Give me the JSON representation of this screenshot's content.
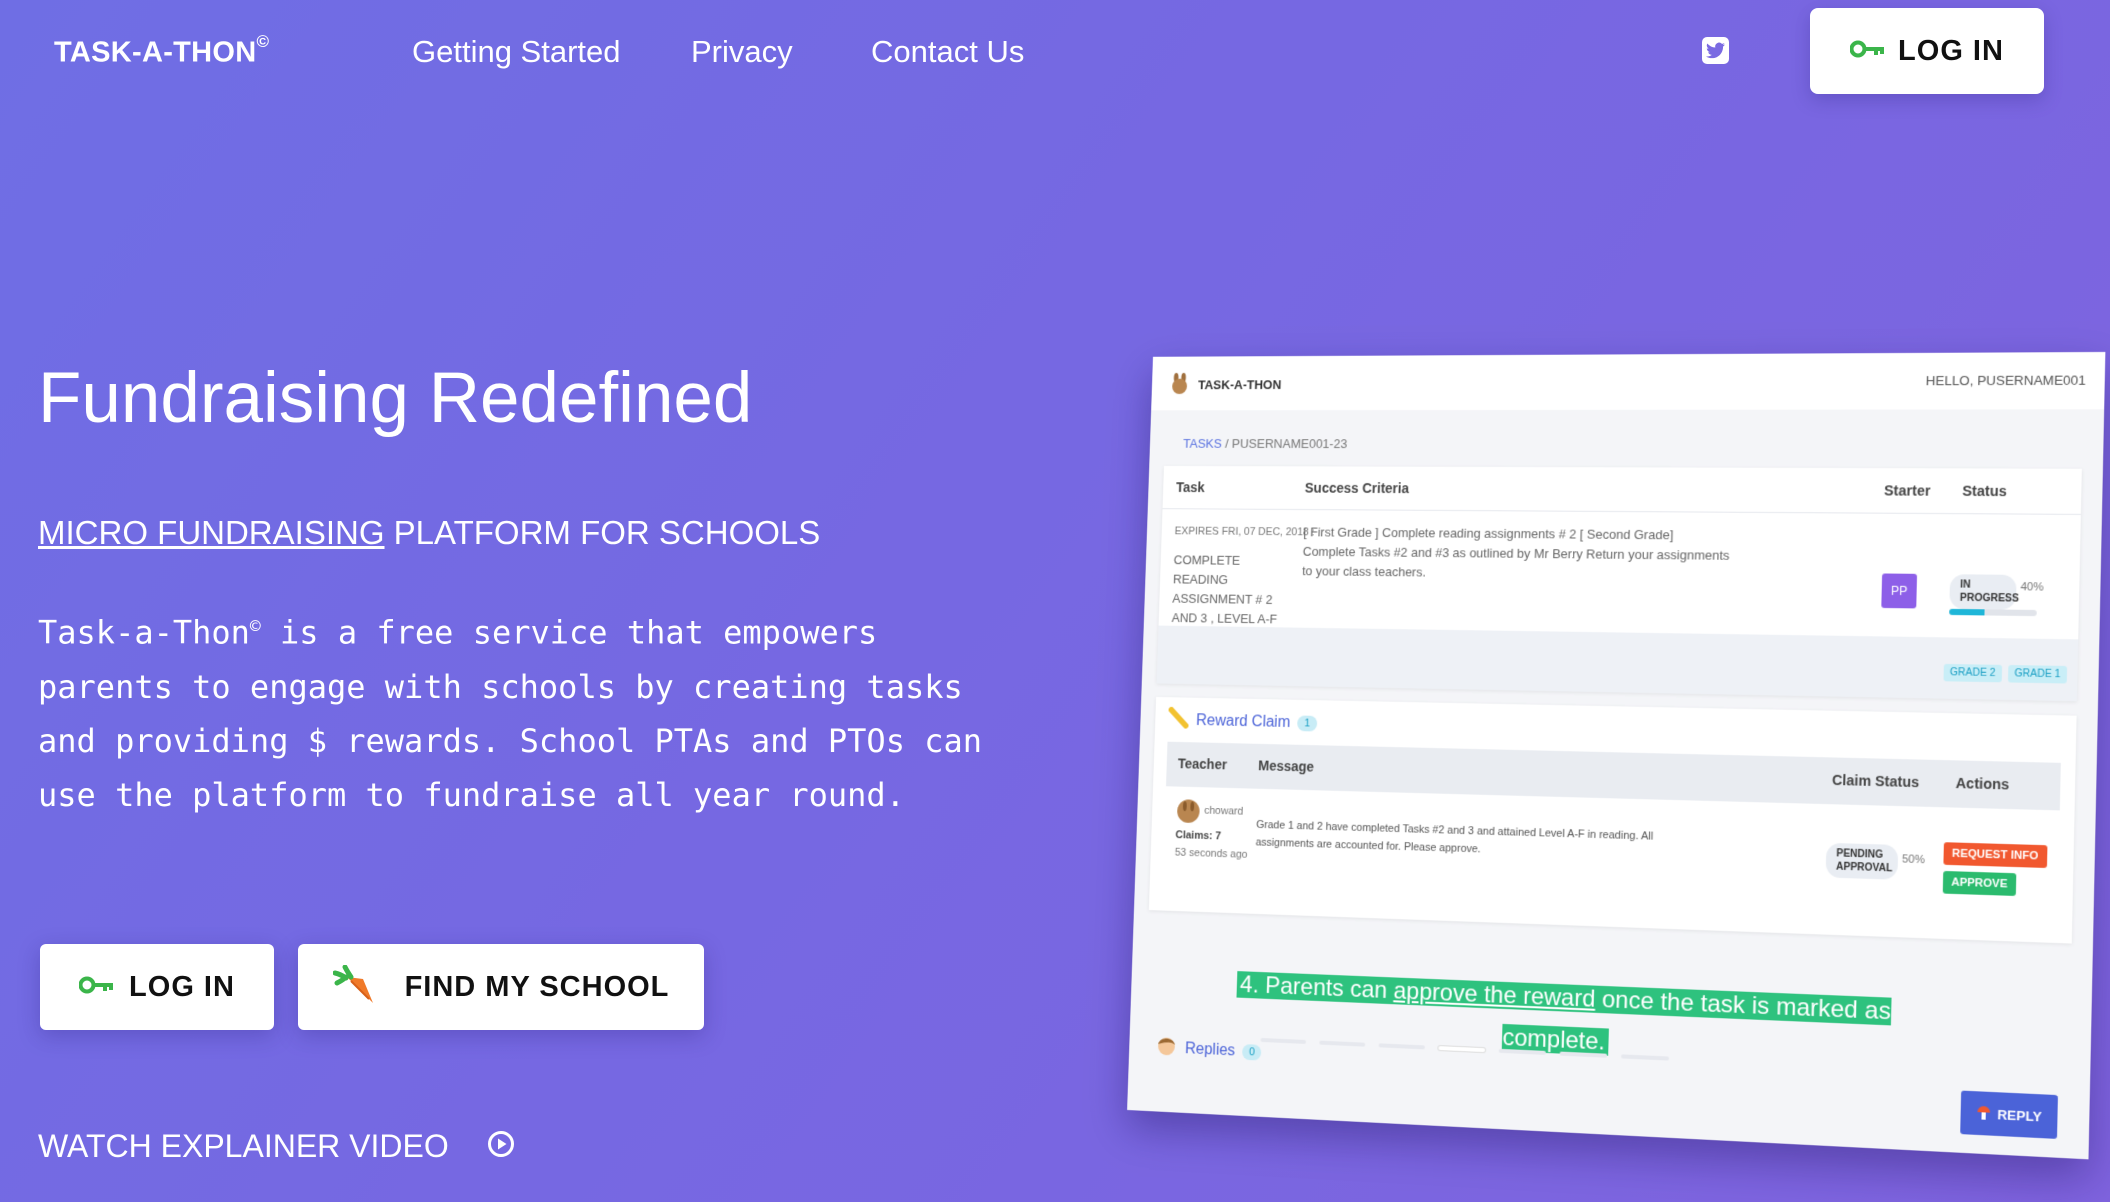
{
  "nav": {
    "brand": "TASK-A-THON",
    "brand_mark": "©",
    "links": [
      "Getting Started",
      "Privacy",
      "Contact Us"
    ],
    "login": "LOG IN",
    "twitter_icon": "twitter-icon"
  },
  "hero": {
    "title": "Fundraising Redefined",
    "subtitle_link": "MICRO FUNDRAISING",
    "subtitle_rest": " PLATFORM FOR SCHOOLS",
    "desc_name": "Task-a-Thon",
    "desc_mark": "©",
    "desc_text": " is a free service that empowers parents to engage with schools by creating tasks and providing $ rewards. School PTAs and PTOs can use the platform to fundraise all year round.",
    "login": "LOG IN",
    "find_school": "FIND MY SCHOOL",
    "video": "WATCH EXPLAINER VIDEO"
  },
  "mockup": {
    "brand": "TASK-A-THON",
    "hello": "HELLO, PUSERNAME001",
    "crumb_tasks": "TASKS",
    "crumb_sep": "/",
    "crumb_id": "PUSERNAME001-23",
    "task_headers": [
      "Task",
      "Success Criteria",
      "Starter",
      "Status"
    ],
    "task_expires": "EXPIRES FRI, 07 DEC, 2018 :",
    "task_name": "COMPLETE READING ASSIGNMENT # 2 AND 3 , LEVEL A-F",
    "task_criteria": "[ First Grade ] Complete reading assignments # 2 [ Second Grade] Complete Tasks #2 and #3 as outlined by Mr Berry Return your assignments to your class teachers.",
    "starter": "PP",
    "status": "IN PROGRESS",
    "status_pct": "40%",
    "status_progress": 0.4,
    "grades": [
      "GRADE 2",
      "GRADE 1"
    ],
    "reward_title": "Reward Claim",
    "reward_count": "1",
    "reward_headers": [
      "Teacher",
      "Message",
      "Claim Status",
      "Actions"
    ],
    "teacher": "choward",
    "claims": "Claims: 7",
    "ago": "53 seconds ago",
    "message": "Grade 1 and 2 have completed Tasks #2 and 3 and attained Level A-F in reading. All assignments are accounted for. Please approve.",
    "claim_status": "PENDING APPROVAL",
    "claim_pct": "50%",
    "request_info": "REQUEST INFO",
    "approve": "APPROVE",
    "replies_title": "Replies",
    "replies_count": "0",
    "reply_btn": "REPLY",
    "caption_a": "4. Parents can ",
    "caption_link": "approve the reward",
    "caption_b": " once the task is marked as complete."
  },
  "colors": {
    "bg_start": "#6f6ee4",
    "bg_end": "#7f63df",
    "key_green": "#3bb54a",
    "caption_green": "#2ec27e",
    "mock_accent": "#4b63d8"
  }
}
